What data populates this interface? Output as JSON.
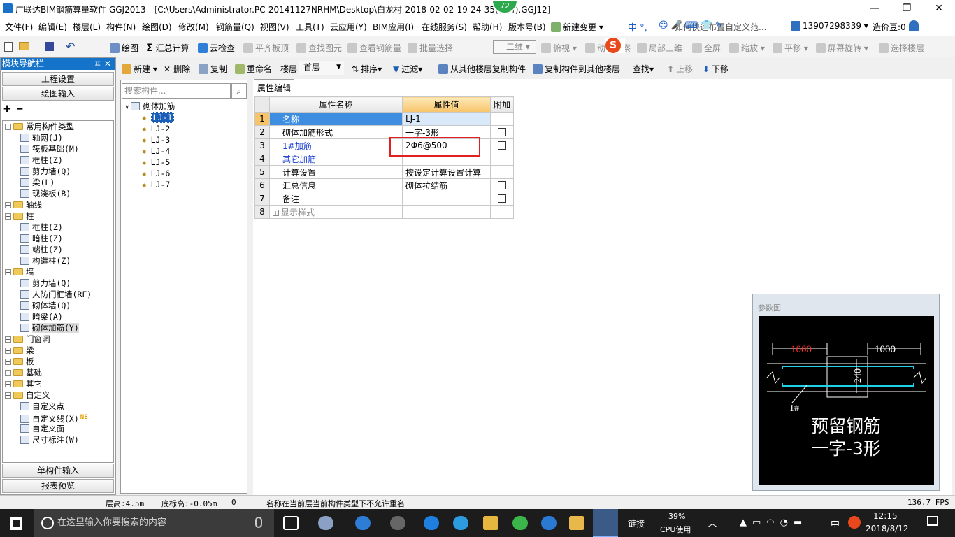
{
  "window": {
    "title": "广联达BIM钢筋算量软件 GGJ2013 - [C:\\Users\\Administrator.PC-20141127NRHM\\Desktop\\白龙村-2018-02-02-19-24-35(备份).GGJ12]",
    "badge": "72",
    "minimize": "—",
    "restore": "❐",
    "close": "✕"
  },
  "menu": {
    "items": [
      "文件(F)",
      "编辑(E)",
      "楼层(L)",
      "构件(N)",
      "绘图(D)",
      "修改(M)",
      "钢筋量(Q)",
      "视图(V)",
      "工具(T)",
      "云应用(Y)",
      "BIM应用(I)",
      "在线服务(S)",
      "帮助(H)",
      "版本号(B)"
    ],
    "new_change": "新建变更",
    "help_hint": "如何快速布置自定义范...",
    "ime_text": "中 °,",
    "phone": "13907298339",
    "cost_bean": "造价豆:0"
  },
  "toolbar": {
    "draw": "绘图",
    "sum_calc": "汇总计算",
    "cloud_check": "云检查",
    "flush_slab": "平齐板顶",
    "find_element": "查找图元",
    "view_rebar": "查看钢筋量",
    "batch_select": "批量选择",
    "view_mode": "二维",
    "top_view": "俯视",
    "dynamic_view": "动态观察",
    "local_3d": "局部三维",
    "fullscreen": "全屏",
    "zoom": "缩放",
    "pan": "平移",
    "rotate": "屏幕旋转",
    "select_floor": "选择楼层"
  },
  "nav": {
    "header": "模块导航栏",
    "pin": "ㅍ ✕",
    "project_settings": "工程设置",
    "drawing_input": "绘图输入",
    "single_input": "单构件输入",
    "report_preview": "报表预览",
    "tree": [
      {
        "label": "常用构件类型",
        "level": 0,
        "kind": "folder",
        "exp": "−"
      },
      {
        "label": "轴网(J)",
        "level": 1,
        "kind": "item"
      },
      {
        "label": "筏板基础(M)",
        "level": 1,
        "kind": "item"
      },
      {
        "label": "框柱(Z)",
        "level": 1,
        "kind": "item"
      },
      {
        "label": "剪力墙(Q)",
        "level": 1,
        "kind": "item"
      },
      {
        "label": "梁(L)",
        "level": 1,
        "kind": "item"
      },
      {
        "label": "现浇板(B)",
        "level": 1,
        "kind": "item"
      },
      {
        "label": "轴线",
        "level": 0,
        "kind": "folder",
        "exp": "+"
      },
      {
        "label": "柱",
        "level": 0,
        "kind": "folder",
        "exp": "−"
      },
      {
        "label": "框柱(Z)",
        "level": 1,
        "kind": "item"
      },
      {
        "label": "暗柱(Z)",
        "level": 1,
        "kind": "item"
      },
      {
        "label": "端柱(Z)",
        "level": 1,
        "kind": "item"
      },
      {
        "label": "构造柱(Z)",
        "level": 1,
        "kind": "item"
      },
      {
        "label": "墙",
        "level": 0,
        "kind": "folder",
        "exp": "−"
      },
      {
        "label": "剪力墙(Q)",
        "level": 1,
        "kind": "item"
      },
      {
        "label": "人防门框墙(RF)",
        "level": 1,
        "kind": "item"
      },
      {
        "label": "砌体墙(Q)",
        "level": 1,
        "kind": "item"
      },
      {
        "label": "暗梁(A)",
        "level": 1,
        "kind": "item"
      },
      {
        "label": "砌体加筋(Y)",
        "level": 1,
        "kind": "item",
        "selected": true
      },
      {
        "label": "门窗洞",
        "level": 0,
        "kind": "folder",
        "exp": "+"
      },
      {
        "label": "梁",
        "level": 0,
        "kind": "folder",
        "exp": "+"
      },
      {
        "label": "板",
        "level": 0,
        "kind": "folder",
        "exp": "+"
      },
      {
        "label": "基础",
        "level": 0,
        "kind": "folder",
        "exp": "+"
      },
      {
        "label": "其它",
        "level": 0,
        "kind": "folder",
        "exp": "+"
      },
      {
        "label": "自定义",
        "level": 0,
        "kind": "folder",
        "exp": "−"
      },
      {
        "label": "自定义点",
        "level": 1,
        "kind": "item"
      },
      {
        "label": "自定义线(X)",
        "level": 1,
        "kind": "item",
        "new": "NE"
      },
      {
        "label": "自定义面",
        "level": 1,
        "kind": "item"
      },
      {
        "label": "尺寸标注(W)",
        "level": 1,
        "kind": "item"
      }
    ]
  },
  "subtoolbar": {
    "new": "新建",
    "delete": "删除",
    "copy": "复制",
    "rename": "重命名",
    "floor_label": "楼层",
    "floor_value": "首层",
    "sort": "排序",
    "filter": "过滤",
    "copy_from_other": "从其他楼层复制构件",
    "copy_to_other": "复制构件到其他楼层",
    "find": "查找",
    "move_up": "上移",
    "move_down": "下移"
  },
  "list": {
    "search_placeholder": "搜索构件...",
    "root": "砌体加筋",
    "items": [
      "LJ-1",
      "LJ-2",
      "LJ-3",
      "LJ-4",
      "LJ-5",
      "LJ-6",
      "LJ-7"
    ]
  },
  "props": {
    "tab": "属性编辑",
    "headers": [
      "属性名称",
      "属性值",
      "附加"
    ],
    "rows": [
      {
        "n": "1",
        "name": "名称",
        "value": "LJ-1",
        "cb": false,
        "blue": true
      },
      {
        "n": "2",
        "name": "砌体加筋形式",
        "value": "一字-3形",
        "cb": true
      },
      {
        "n": "3",
        "name": "1#加筋",
        "value": "2Φ6@500",
        "cb": true,
        "blue": true
      },
      {
        "n": "4",
        "name": "其它加筋",
        "value": "",
        "cb": false,
        "blue": true
      },
      {
        "n": "5",
        "name": "计算设置",
        "value": "按设定计算设置计算",
        "cb": false
      },
      {
        "n": "6",
        "name": "汇总信息",
        "value": "砌体拉结筋",
        "cb": true
      },
      {
        "n": "7",
        "name": "备注",
        "value": "",
        "cb": true
      },
      {
        "n": "8",
        "name": "显示样式",
        "value": "",
        "cb": false,
        "expander": true
      }
    ]
  },
  "param_image": {
    "title": "参数图",
    "dim_left": "1000",
    "dim_right": "1000",
    "dim_width": "240",
    "bar_label": "1#",
    "caption_1": "预留钢筋",
    "caption_2": "一字-3形"
  },
  "status": {
    "floor_height": "层高:4.5m",
    "bottom_elev": "底标高:-0.05m",
    "zero": "0",
    "message": "名称在当前层当前构件类型下不允许重名",
    "fps": "136.7 FPS"
  },
  "taskbar": {
    "search": "在这里输入你要搜索的内容",
    "link": "链接",
    "cpu_pct": "39%",
    "cpu_label": "CPU使用",
    "ime": "中",
    "time": "12:15",
    "date": "2018/8/12"
  }
}
